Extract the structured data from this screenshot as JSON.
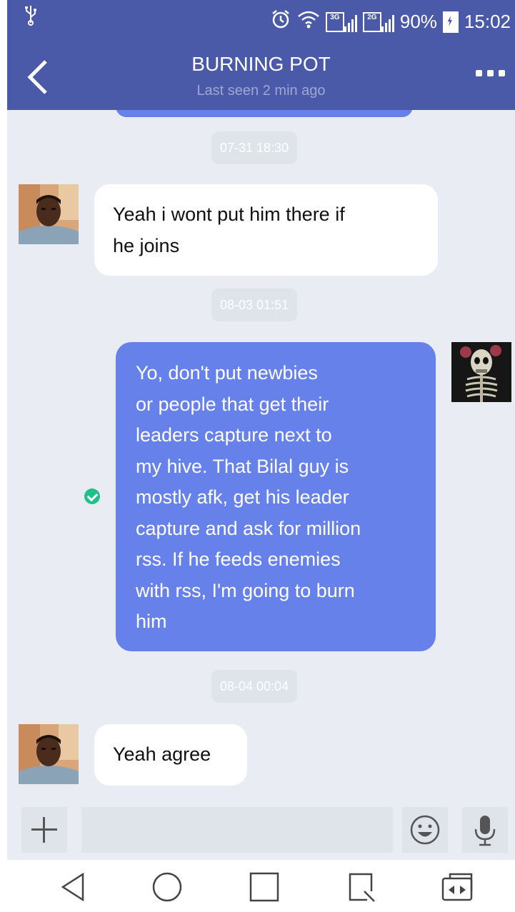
{
  "status_bar": {
    "usb_icon": "usb-icon",
    "network_1": "3G",
    "network_2": "2G",
    "battery": "90%",
    "time": "15:02"
  },
  "header": {
    "title": "BURNING POT",
    "subtitle": "Last seen 2 min ago"
  },
  "messages": [
    {
      "type": "timestamp",
      "text": "07-31 18:30"
    },
    {
      "type": "incoming",
      "lines": [
        "Yeah i wont put him there if",
        "he joins"
      ]
    },
    {
      "type": "timestamp",
      "text": "08-03 01:51"
    },
    {
      "type": "outgoing",
      "status": "read",
      "lines": [
        "Yo, don't put newbies",
        "or people that get their",
        "leaders capture next to",
        "my hive. That Bilal guy is",
        "mostly afk, get his leader",
        "capture and ask for million",
        "rss. If he feeds enemies",
        "with rss, I'm going to burn",
        "him"
      ]
    },
    {
      "type": "timestamp",
      "text": "08-04 00:04"
    },
    {
      "type": "incoming",
      "lines": [
        "Yeah agree"
      ]
    }
  ],
  "input_bar": {
    "placeholder": "",
    "icons": [
      "plus-icon",
      "emoji-icon",
      "microphone-icon"
    ]
  },
  "nav_bar": {
    "icons": [
      "back-triangle-icon",
      "home-circle-icon",
      "recents-square-icon",
      "notification-pull-icon",
      "dual-window-icon"
    ]
  },
  "colors": {
    "header": "#4a5aa8",
    "outgoing_bubble": "#6781ea",
    "chat_background": "#e9edf3",
    "read_check": "#21c08b"
  }
}
